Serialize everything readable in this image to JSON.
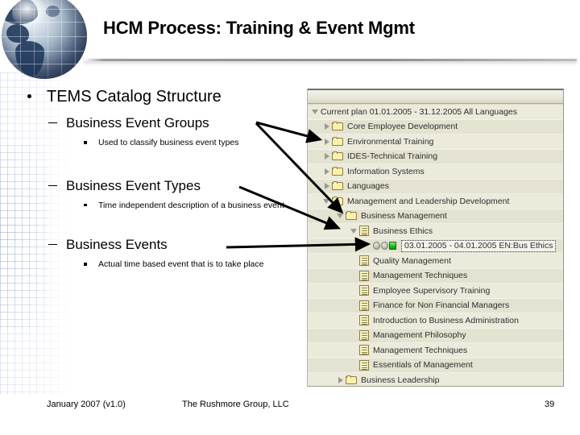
{
  "slide": {
    "title": "HCM Process: Training & Event Mgmt",
    "logo_icon": "globe-icon"
  },
  "outline": {
    "heading": "TEMS Catalog Structure",
    "items": [
      {
        "title": "Business Event Groups",
        "detail": "Used to classify business event types"
      },
      {
        "title": "Business Event Types",
        "detail": "Time independent description of a business event"
      },
      {
        "title": "Business Events",
        "detail": "Actual time based event that is to take place"
      }
    ]
  },
  "tree_panel": {
    "root": "Current plan 01.01.2005 - 31.12.2005 All Languages",
    "rows": [
      {
        "label": "Core Employee Development",
        "icon": "folder-icon",
        "twisty": "collapsed",
        "indent": 1
      },
      {
        "label": "Environmental Training",
        "icon": "folder-icon",
        "twisty": "collapsed",
        "indent": 1
      },
      {
        "label": "IDES-Technical Training",
        "icon": "folder-icon",
        "twisty": "collapsed",
        "indent": 1
      },
      {
        "label": "Information Systems",
        "icon": "folder-icon",
        "twisty": "collapsed",
        "indent": 1
      },
      {
        "label": "Languages",
        "icon": "folder-icon",
        "twisty": "collapsed",
        "indent": 1
      },
      {
        "label": "Management and Leadership Development",
        "icon": "folder-icon",
        "twisty": "expanded",
        "indent": 1
      },
      {
        "label": "Business Management",
        "icon": "folder-icon",
        "twisty": "expanded",
        "indent": 2
      },
      {
        "label": "Business Ethics",
        "icon": "document-icon",
        "twisty": "expanded",
        "indent": 3
      },
      {
        "label": "03.01.2005 - 04.01.2005 EN:Bus Ethics",
        "icon": "traffic-lights-icon",
        "twisty": "none",
        "indent": 4,
        "selected": true
      },
      {
        "label": "Quality Management",
        "icon": "document-icon",
        "twisty": "none",
        "indent": 3
      },
      {
        "label": "Management Techniques",
        "icon": "document-icon",
        "twisty": "none",
        "indent": 3
      },
      {
        "label": "Employee Supervisory Training",
        "icon": "document-icon",
        "twisty": "none",
        "indent": 3
      },
      {
        "label": "Finance for Non Financial Managers",
        "icon": "document-icon",
        "twisty": "none",
        "indent": 3
      },
      {
        "label": "Introduction to Business Administration",
        "icon": "document-icon",
        "twisty": "none",
        "indent": 3
      },
      {
        "label": "Management Philosophy",
        "icon": "document-icon",
        "twisty": "none",
        "indent": 3
      },
      {
        "label": "Management Techniques",
        "icon": "document-icon",
        "twisty": "none",
        "indent": 3
      },
      {
        "label": "Essentials of Management",
        "icon": "document-icon",
        "twisty": "none",
        "indent": 3
      },
      {
        "label": "Business Leadership",
        "icon": "folder-icon",
        "twisty": "collapsed",
        "indent": 2
      }
    ]
  },
  "footer": {
    "date": "January 2007 (v1.0)",
    "company": "The Rushmore Group, LLC",
    "page_number": "39"
  },
  "colors": {
    "panel_bg": "#dedcc8",
    "folder": "#fbf0ad",
    "status_green": "#21c021",
    "text": "#000000"
  }
}
